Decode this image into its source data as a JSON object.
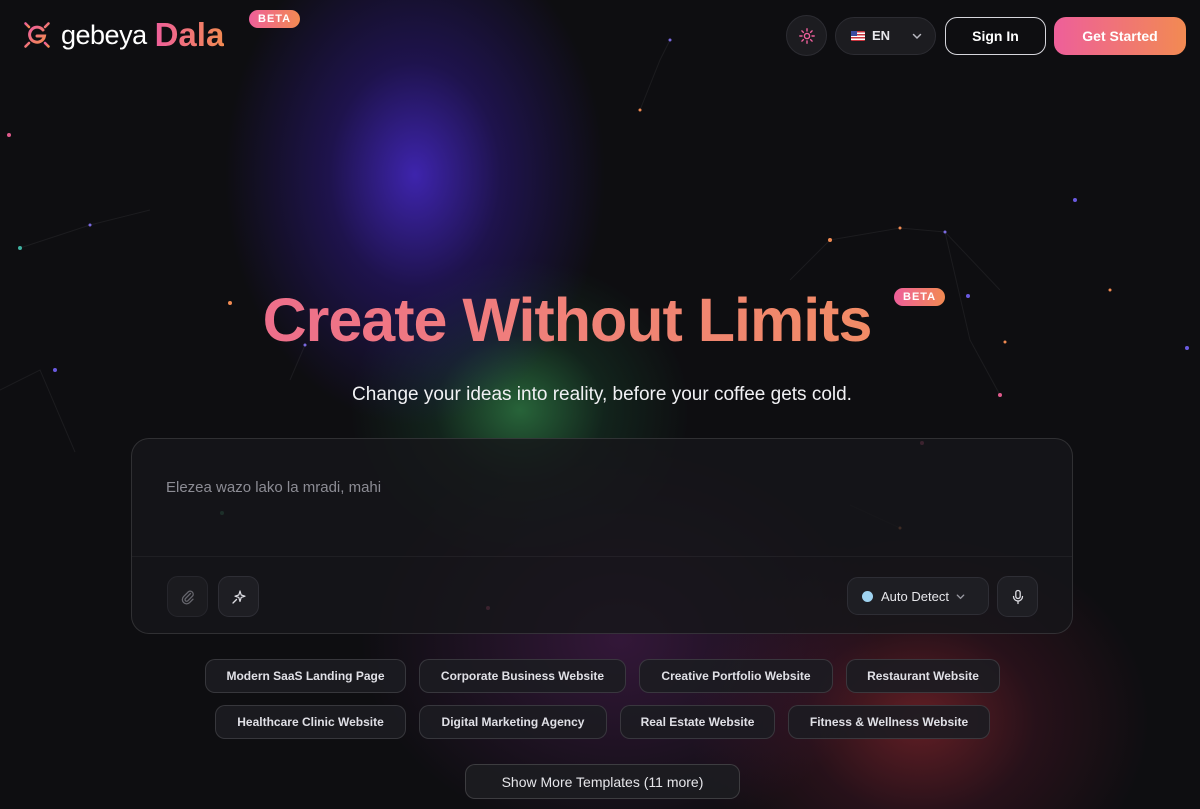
{
  "header": {
    "logo_word": "gebeya",
    "logo_product": "Dala",
    "logo_badge": "BETA",
    "theme_icon": "sun-icon",
    "language": {
      "flag": "us-flag-icon",
      "code": "EN"
    },
    "signin_label": "Sign In",
    "get_started_label": "Get Started"
  },
  "hero": {
    "title": "Create Without Limits",
    "badge": "BETA",
    "subtitle": "Change your ideas into reality, before your coffee gets cold."
  },
  "prompt": {
    "placeholder": "Elezea wazo lako la mradi, mahi",
    "attach_icon": "paperclip-icon",
    "enhance_icon": "sparkle-icon",
    "language_detect": "Auto Detect",
    "mic_icon": "microphone-icon"
  },
  "templates": {
    "row1": [
      "Modern SaaS Landing Page",
      "Corporate Business Website",
      "Creative Portfolio Website",
      "Restaurant Website"
    ],
    "row2": [
      "Healthcare Clinic Website",
      "Digital Marketing Agency",
      "Real Estate Website",
      "Fitness & Wellness Website"
    ],
    "show_more_label": "Show More Templates (11 more)"
  },
  "colors": {
    "accent_pink": "#ee5f9a",
    "accent_orange": "#f28a52",
    "background": "#0e0e11"
  }
}
